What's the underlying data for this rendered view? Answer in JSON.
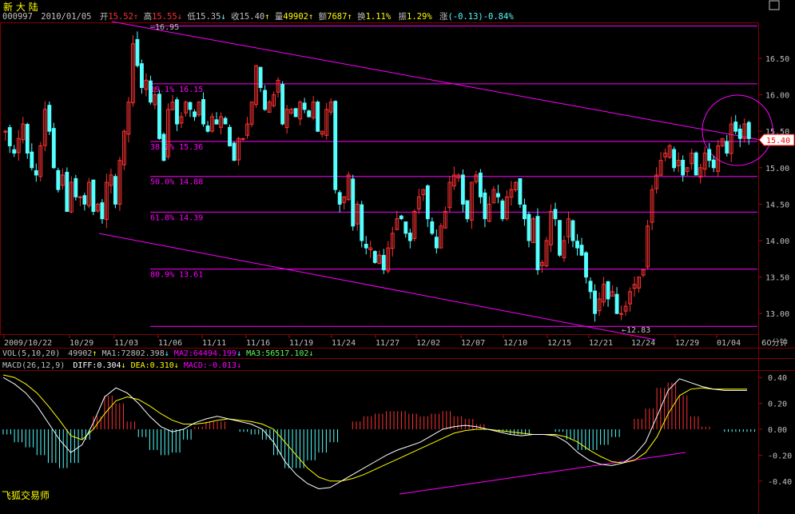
{
  "stock": {
    "name": "新 大 陆"
  },
  "header": {
    "code": "000997",
    "date": "2010/01/05",
    "open_label": "开",
    "open": "15.52",
    "high_label": "高",
    "high": "15.55",
    "low_label": "低",
    "low": "15.35",
    "close_label": "收",
    "close": "15.40",
    "volume_label": "量",
    "volume": "49902",
    "amount_label": "额",
    "amount": "7687",
    "turnover_label": "换",
    "turnover": "1.11%",
    "amplitude_label": "振",
    "amplitude": "1.29%",
    "change_label": "涨",
    "change": "(-0.13)-0.84%"
  },
  "price_axis": {
    "ticks": [
      {
        "value": 16.5,
        "label": "16.50"
      },
      {
        "value": 16.0,
        "label": "16.00"
      },
      {
        "value": 15.5,
        "label": "15.50"
      },
      {
        "value": 15.0,
        "label": "15.00"
      },
      {
        "value": 14.5,
        "label": "14.50"
      },
      {
        "value": 14.0,
        "label": "14.00"
      },
      {
        "value": 13.5,
        "label": "13.50"
      },
      {
        "value": 13.0,
        "label": "13.00"
      }
    ],
    "current_price": "15.40"
  },
  "date_axis": {
    "labels": [
      "2009/10/22",
      "10/29",
      "11/03",
      "11/06",
      "11/11",
      "11/16",
      "11/19",
      "11/24",
      "11/27",
      "12/02",
      "12/07",
      "12/10",
      "12/15",
      "12/21",
      "12/24",
      "12/29",
      "01/04"
    ],
    "period": "60分钟"
  },
  "annotations": {
    "high_mark": "16.95",
    "low_mark": "12.83",
    "fib_levels": [
      {
        "price": 16.15,
        "label": "19.1% 16.15"
      },
      {
        "price": 15.36,
        "label": "38.2% 15.36"
      },
      {
        "price": 14.88,
        "label": "50.0% 14.88"
      },
      {
        "price": 14.39,
        "label": "61.8% 14.39"
      },
      {
        "price": 13.61,
        "label": "80.9% 13.61"
      }
    ]
  },
  "vol_bar": {
    "title": "VOL(5,10,20)",
    "value": "49902",
    "ma1": "MA1:72802.398",
    "ma2": "MA2:64494.199",
    "ma3": "MA3:56517.102"
  },
  "macd_bar": {
    "title": "MACD(26,12,9)",
    "diff": "DIFF:0.304",
    "dea": "DEA:0.310",
    "macd": "MACD:-0.013"
  },
  "macd_axis": {
    "ticks": [
      {
        "value": 0.4,
        "label": "0.40"
      },
      {
        "value": 0.2,
        "label": "0.20"
      },
      {
        "value": 0.0,
        "label": "0.00"
      },
      {
        "value": -0.2,
        "label": "-0.20"
      },
      {
        "value": -0.4,
        "label": "-0.40"
      }
    ]
  },
  "software": "飞狐交易师",
  "colors": {
    "up": "#ff3232",
    "down": "#54ffff",
    "magenta": "#ff00ff",
    "text_yellow": "#ffff00",
    "diff": "#ffffff",
    "dea": "#ffff00",
    "grid": "#800000"
  },
  "chart_data": [
    {
      "type": "candlestick",
      "x_range": [
        "2009/10/22",
        "2010/01/05"
      ],
      "ylim": [
        12.75,
        17.0
      ],
      "closes": [
        15.5,
        15.3,
        15.2,
        15.4,
        15.6,
        15.2,
        15.0,
        14.9,
        15.3,
        15.8,
        15.5,
        15.0,
        14.7,
        14.9,
        14.4,
        14.8,
        14.6,
        14.6,
        14.5,
        14.8,
        14.4,
        14.5,
        14.3,
        14.8,
        14.9,
        14.5,
        15.1,
        15.5,
        15.9,
        16.7,
        16.4,
        16.1,
        16.2,
        15.9,
        16.0,
        15.4,
        15.1,
        15.8,
        15.9,
        15.6,
        15.7,
        15.9,
        15.8,
        15.7,
        15.9,
        15.6,
        15.5,
        15.7,
        15.6,
        15.7,
        15.6,
        15.3,
        15.1,
        15.4,
        15.4,
        15.6,
        15.9,
        16.4,
        16.1,
        15.8,
        15.9,
        16.0,
        16.2,
        15.6,
        15.8,
        15.8,
        15.7,
        15.9,
        15.8,
        15.7,
        15.9,
        15.5,
        15.5,
        15.8,
        15.9,
        14.7,
        14.5,
        14.6,
        14.9,
        14.2,
        14.5,
        14.0,
        13.9,
        13.9,
        13.7,
        13.8,
        13.6,
        13.9,
        14.1,
        14.3,
        14.3,
        14.1,
        14.0,
        14.4,
        14.6,
        14.7,
        14.3,
        14.1,
        13.9,
        14.2,
        14.4,
        14.8,
        14.9,
        14.9,
        14.5,
        14.3,
        14.8,
        14.9,
        14.6,
        14.3,
        14.5,
        14.7,
        14.6,
        14.3,
        14.6,
        14.7,
        14.8,
        14.5,
        14.3,
        14.0,
        14.3,
        13.6,
        13.7,
        14.0,
        14.4,
        14.3,
        13.8,
        14.0,
        14.3,
        14.0,
        13.9,
        13.8,
        13.5,
        13.3,
        13.0,
        13.2,
        13.4,
        13.2,
        13.3,
        13.0,
        13.0,
        13.1,
        13.3,
        13.4,
        13.5,
        13.6,
        14.2,
        14.7,
        14.9,
        15.1,
        15.2,
        15.3,
        15.0,
        15.1,
        14.9,
        15.0,
        15.2,
        14.9,
        15.0,
        15.2,
        15.1,
        15.0,
        15.3,
        15.4,
        15.2,
        15.6,
        15.5,
        15.4,
        15.6,
        15.4
      ],
      "last_close": 15.4
    },
    {
      "type": "line",
      "title": "MACD(26,12,9)",
      "ylim": [
        -0.5,
        0.5
      ],
      "diff": [
        0.4,
        0.35,
        0.28,
        0.18,
        0.05,
        -0.08,
        -0.18,
        -0.12,
        0.05,
        0.25,
        0.32,
        0.28,
        0.2,
        0.1,
        0.02,
        -0.02,
        0.0,
        0.05,
        0.08,
        0.1,
        0.08,
        0.06,
        0.04,
        0.0,
        -0.1,
        -0.25,
        -0.35,
        -0.42,
        -0.46,
        -0.45,
        -0.4,
        -0.35,
        -0.3,
        -0.25,
        -0.2,
        -0.16,
        -0.13,
        -0.1,
        -0.05,
        0.0,
        0.02,
        0.03,
        0.02,
        0.0,
        -0.02,
        -0.04,
        -0.05,
        -0.04,
        -0.04,
        -0.05,
        -0.1,
        -0.18,
        -0.24,
        -0.27,
        -0.28,
        -0.26,
        -0.2,
        -0.1,
        0.1,
        0.3,
        0.39,
        0.36,
        0.33,
        0.31,
        0.3,
        0.3,
        0.3
      ],
      "dea": [
        0.42,
        0.4,
        0.35,
        0.28,
        0.18,
        0.07,
        -0.05,
        -0.08,
        0.0,
        0.12,
        0.22,
        0.25,
        0.23,
        0.18,
        0.12,
        0.07,
        0.04,
        0.04,
        0.05,
        0.07,
        0.08,
        0.07,
        0.06,
        0.04,
        0.0,
        -0.1,
        -0.2,
        -0.3,
        -0.37,
        -0.4,
        -0.4,
        -0.38,
        -0.35,
        -0.31,
        -0.27,
        -0.23,
        -0.19,
        -0.15,
        -0.11,
        -0.07,
        -0.03,
        -0.01,
        0.0,
        0.0,
        -0.01,
        -0.02,
        -0.03,
        -0.04,
        -0.04,
        -0.04,
        -0.06,
        -0.1,
        -0.16,
        -0.21,
        -0.25,
        -0.26,
        -0.24,
        -0.18,
        -0.06,
        0.12,
        0.26,
        0.31,
        0.32,
        0.31,
        0.31,
        0.31,
        0.31
      ]
    }
  ]
}
